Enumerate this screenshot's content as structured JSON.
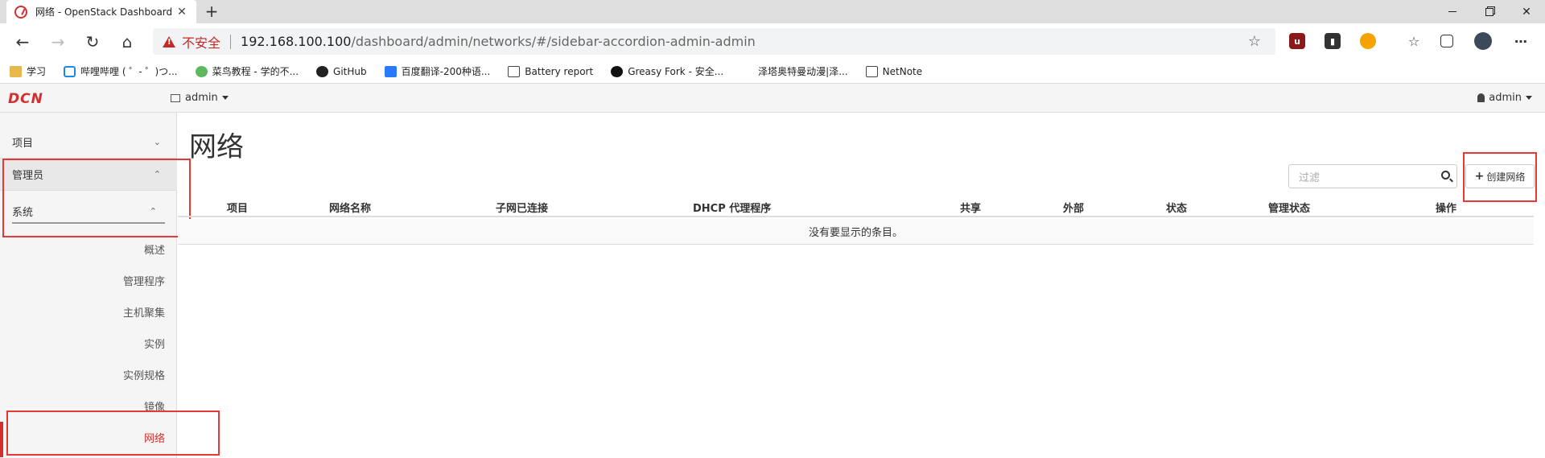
{
  "browser": {
    "tab_title": "网络 - OpenStack Dashboard",
    "tab_close": "✕",
    "new_tab": "+",
    "insecure_label": "不安全",
    "url_host": "192.168.100.100",
    "url_path": "/dashboard/admin/networks/#/sidebar-accordion-admin-admin",
    "more": "⋯"
  },
  "bookmarks": [
    {
      "label": "学习",
      "icon": "folder-icon"
    },
    {
      "label": "哔哩哔哩 ( ゜- ゜)つ...",
      "icon": "bilibili-icon"
    },
    {
      "label": "菜鸟教程 - 学的不...",
      "icon": "runoob-icon"
    },
    {
      "label": "GitHub",
      "icon": "github-icon"
    },
    {
      "label": "百度翻译-200种语...",
      "icon": "baidu-translate-icon"
    },
    {
      "label": "Battery report",
      "icon": "document-icon"
    },
    {
      "label": "Greasy Fork - 安全...",
      "icon": "greasyfork-icon"
    },
    {
      "label": "泽塔奥特曼动漫|泽...",
      "icon": "blank-icon"
    },
    {
      "label": "NetNote",
      "icon": "document-icon"
    }
  ],
  "dashboard": {
    "brand": "DCN",
    "project": "admin",
    "user": "admin"
  },
  "sidebar": {
    "project": "项目",
    "admin": "管理员",
    "system": "系统",
    "items": [
      "概述",
      "管理程序",
      "主机聚集",
      "实例",
      "实例规格",
      "镜像",
      "网络"
    ]
  },
  "main": {
    "title": "网络",
    "filter_placeholder": "过滤",
    "create_button": "创建网络",
    "columns": [
      "项目",
      "网络名称",
      "子网已连接",
      "DHCP 代理程序",
      "共享",
      "外部",
      "状态",
      "管理状态",
      "操作"
    ],
    "empty_message": "没有要显示的条目。"
  },
  "colors": {
    "accent": "#d32f2f",
    "highlight_box": "#e53935"
  }
}
